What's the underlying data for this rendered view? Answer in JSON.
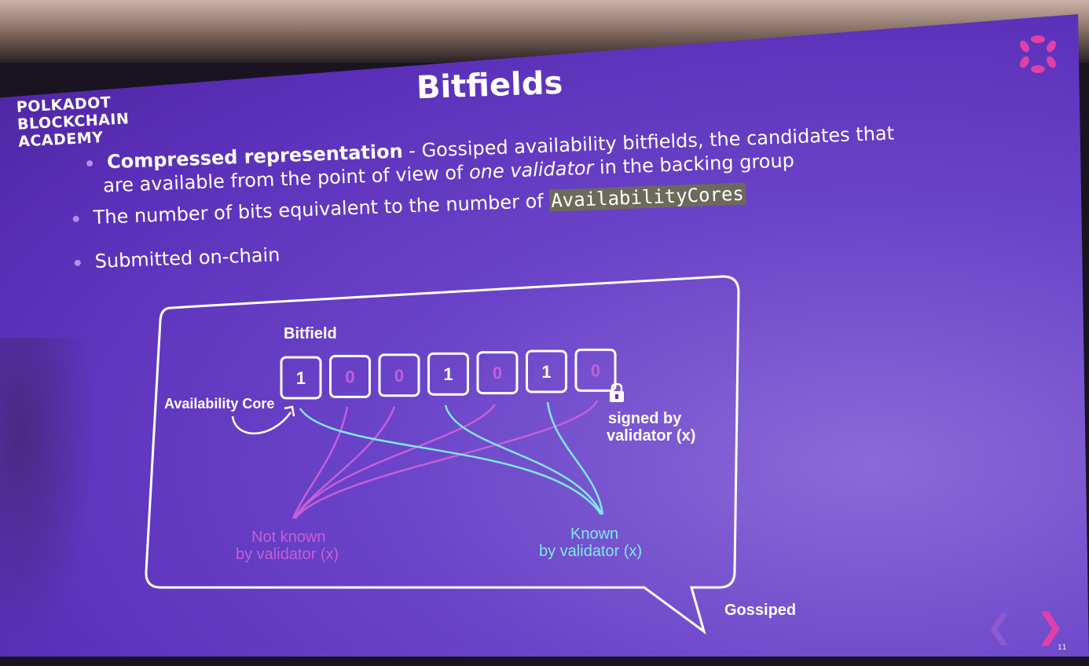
{
  "brand": {
    "line1": "POLKADOT",
    "line2": "BLOCKCHAIN",
    "line3": "ACADEMY"
  },
  "title": "Bitfields",
  "bullets": {
    "b1_strong": "Compressed representation",
    "b1_rest": " - Gossiped availability bitfields, the candidates that",
    "b1_line2_pre": "are available from the point of view of ",
    "b1_line2_em": "one validator",
    "b1_line2_post": " in the backing group",
    "b2_pre": "The number of bits equivalent to the number of ",
    "b2_code": "AvailabilityCores",
    "b3": "Submitted on-chain"
  },
  "diagram": {
    "bitfield_label": "Bitfield",
    "bits": [
      "1",
      "0",
      "0",
      "1",
      "0",
      "1",
      "0"
    ],
    "availability_core": "Availability Core",
    "signed_line1": "signed by",
    "signed_line2": "validator (x)",
    "not_known_line1": "Not known",
    "not_known_line2": "by validator (x)",
    "known_line1": "Known",
    "known_line2": "by validator (x)",
    "gossiped": "Gossiped"
  },
  "page_number": "11",
  "colors": {
    "accent_pink": "#e040a8",
    "cyan": "#7ee8f0",
    "magenta": "#c060d8",
    "slide": "#5a2fb8"
  }
}
